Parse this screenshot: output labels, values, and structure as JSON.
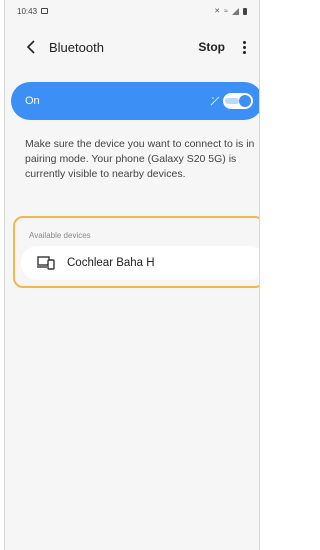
{
  "status_bar": {
    "time": "10:43"
  },
  "header": {
    "title": "Bluetooth",
    "stop_label": "Stop"
  },
  "bluetooth_toggle": {
    "label": "On",
    "state": "on",
    "accent_color": "#3b8ff5"
  },
  "info": {
    "text": "Make sure the device you want to connect to is in pairing mode. Your phone (Galaxy S20 5G) is currently visible to nearby devices."
  },
  "available_devices": {
    "header": "Available devices",
    "items": [
      {
        "name": "Cochlear Baha H",
        "icon": "devices-icon"
      }
    ]
  },
  "highlight_color": "#f2b84b"
}
